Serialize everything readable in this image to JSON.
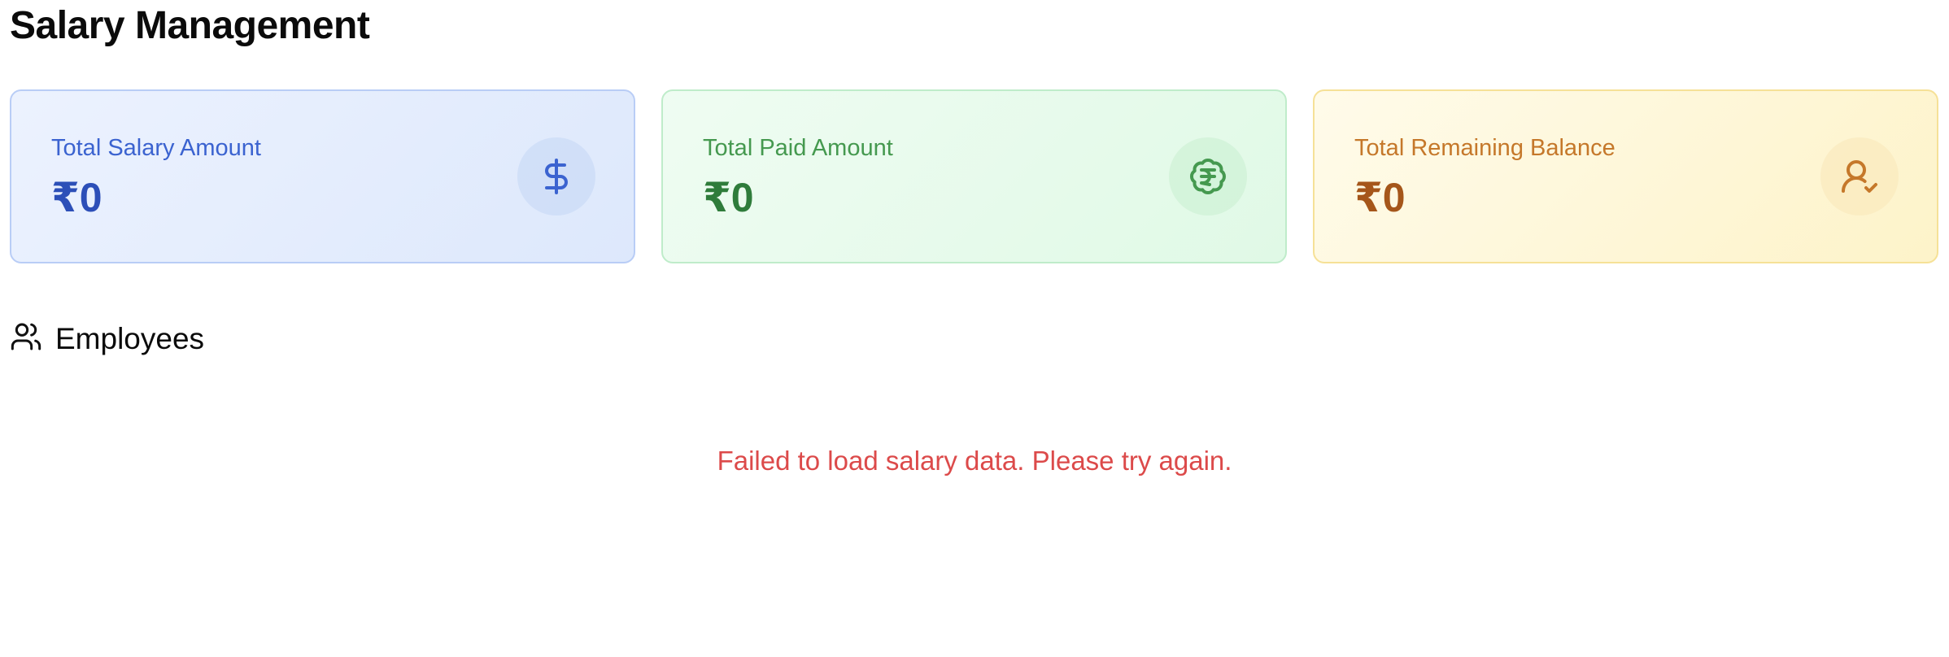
{
  "page": {
    "title": "Salary Management"
  },
  "summary_cards": [
    {
      "label": "Total Salary Amount",
      "value": "₹0",
      "icon": "dollar-icon",
      "accent": "#2c4fb8"
    },
    {
      "label": "Total Paid Amount",
      "value": "₹0",
      "icon": "rupee-badge-icon",
      "accent": "#2f7c3b"
    },
    {
      "label": "Total Remaining Balance",
      "value": "₹0",
      "icon": "user-check-icon",
      "accent": "#a5561a"
    }
  ],
  "employees_section": {
    "title": "Employees",
    "icon": "users-icon",
    "error_message": "Failed to load salary data. Please try again.",
    "error_color": "#dc4a4a"
  }
}
